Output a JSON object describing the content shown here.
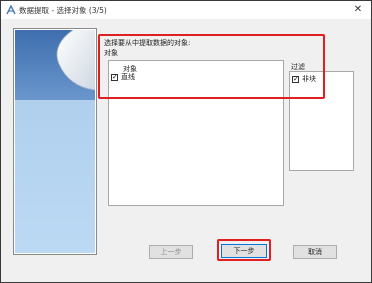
{
  "window": {
    "title": "数据提取 - 选择对象 (3/5)",
    "close_glyph": "✕",
    "app_icon": "autocad-icon"
  },
  "prompt": "选择要从中提取数据的对象:",
  "objects": {
    "group_label": "对象",
    "column_header": "对象",
    "rows": [
      {
        "label": "直线",
        "checked": true
      }
    ]
  },
  "filter": {
    "label": "过滤",
    "rows": [
      {
        "label": "非块",
        "checked": true
      }
    ]
  },
  "buttons": {
    "prev": "上一步",
    "next": "下一步",
    "cancel": "取消"
  },
  "colors": {
    "accent": "#0078d7",
    "highlight": "#e02020",
    "side_top": "#3e6eae",
    "side_bottom": "#bcd9f3"
  }
}
